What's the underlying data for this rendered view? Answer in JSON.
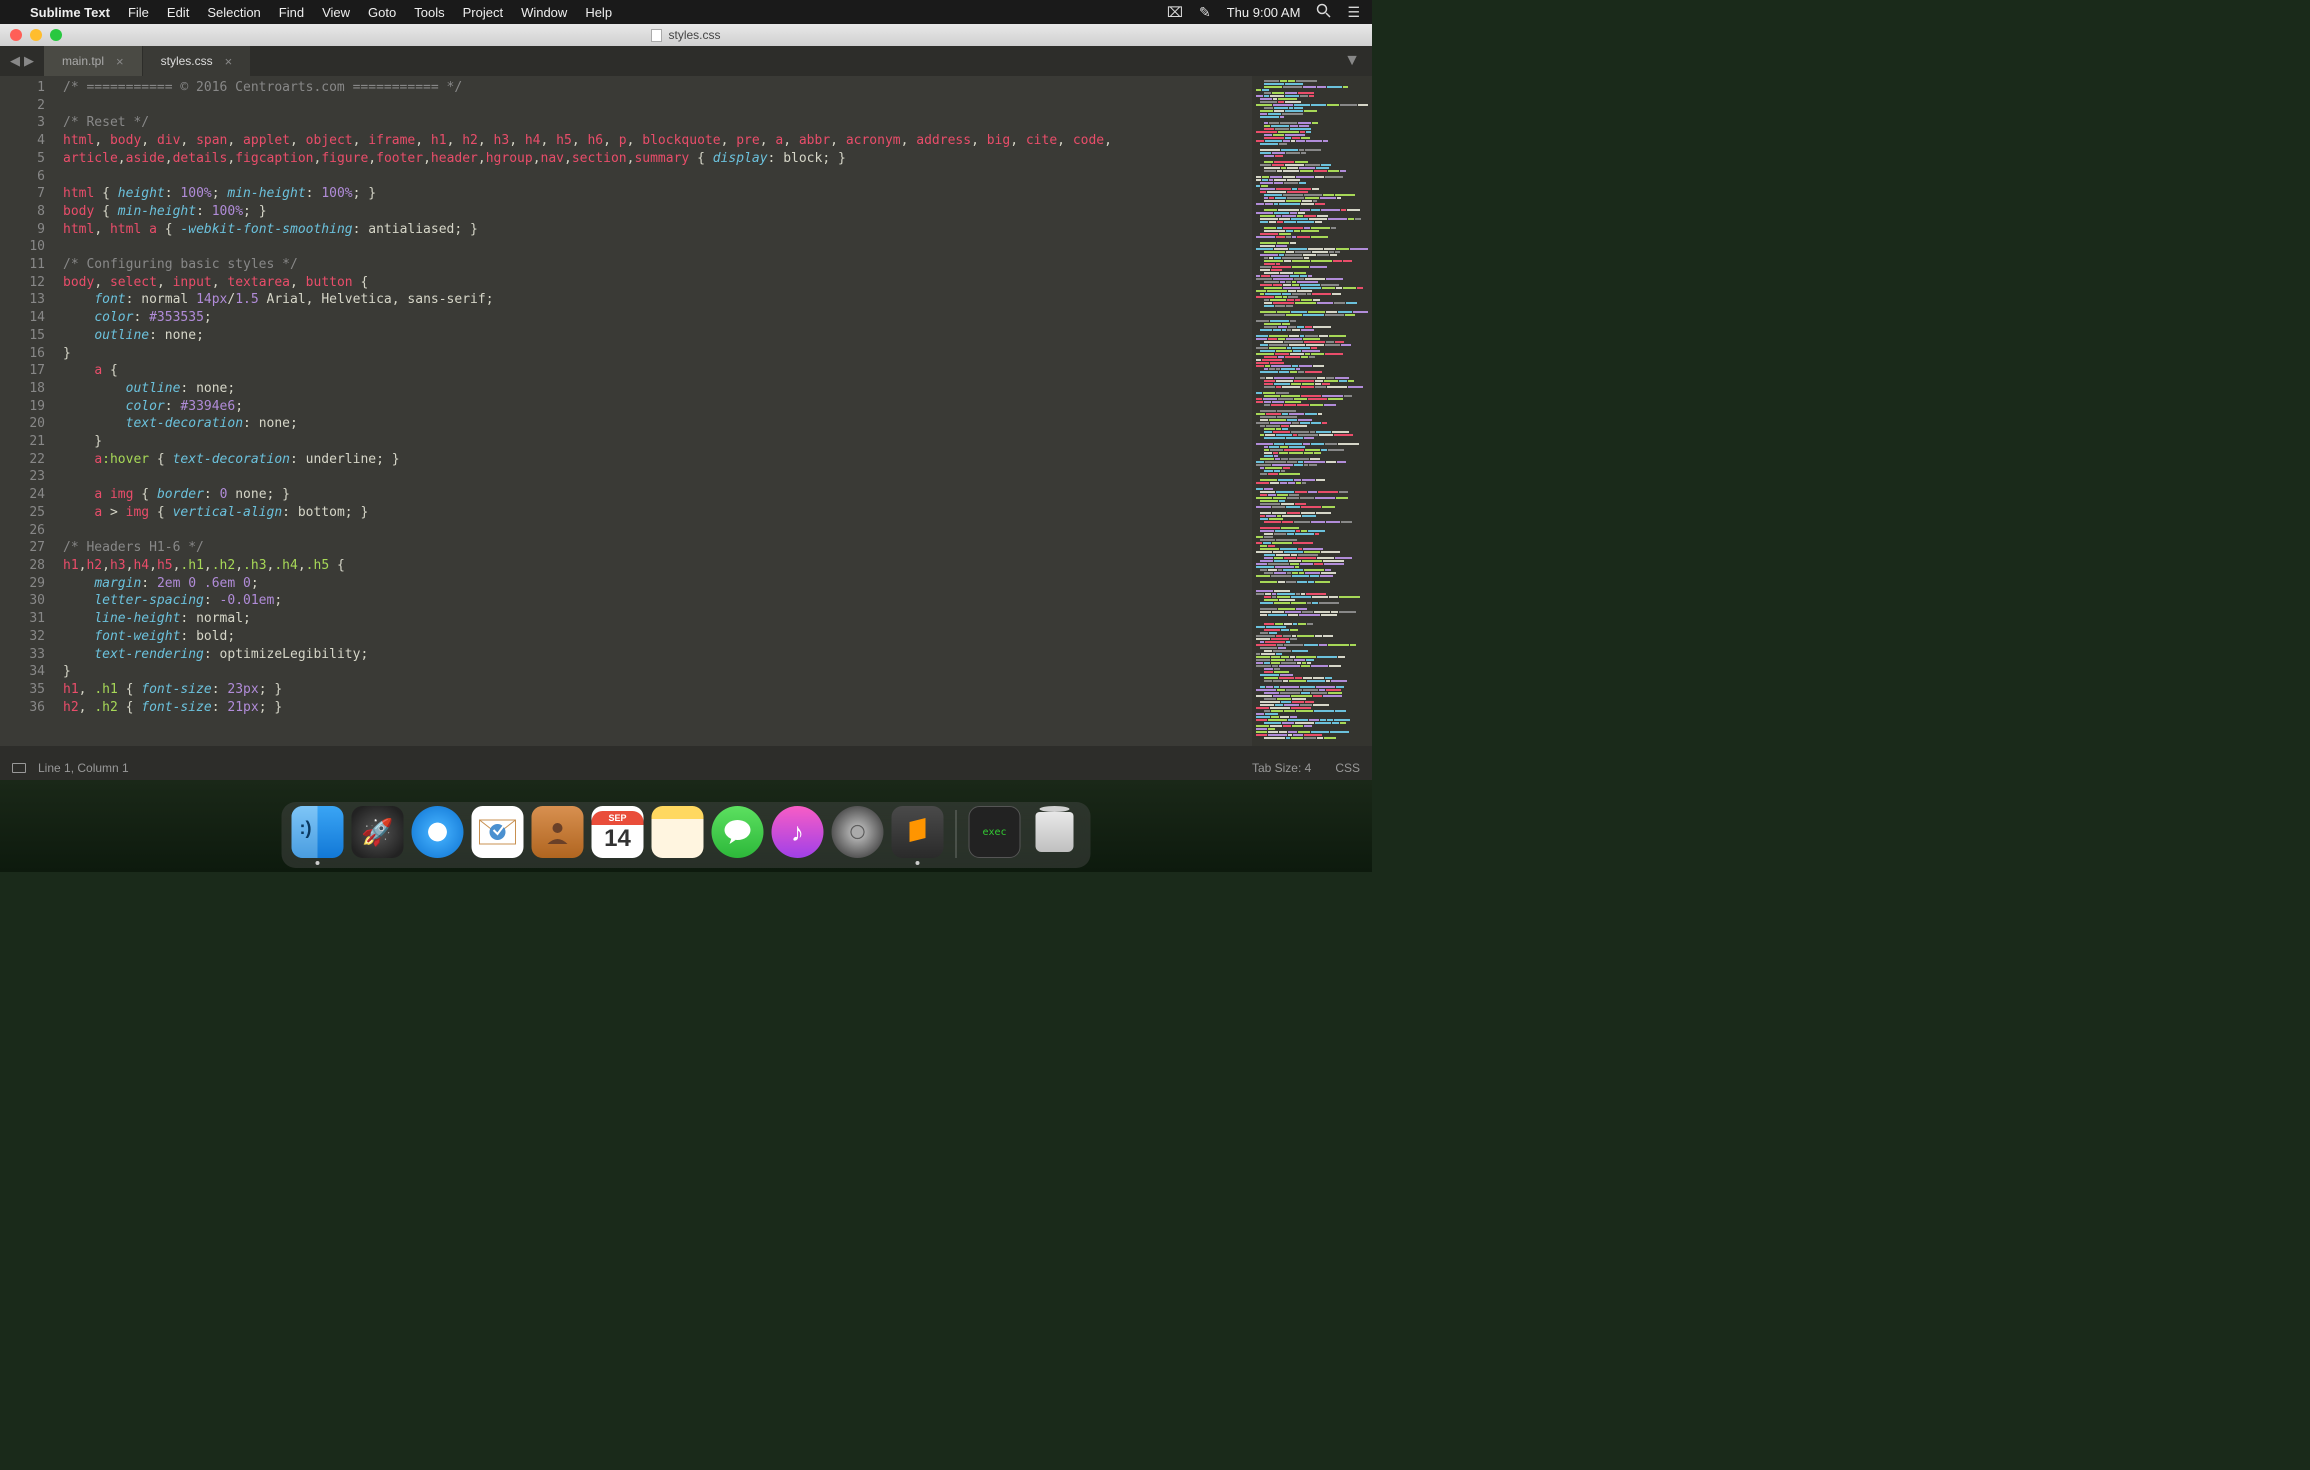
{
  "menubar": {
    "app_name": "Sublime Text",
    "items": [
      "File",
      "Edit",
      "Selection",
      "Find",
      "View",
      "Goto",
      "Tools",
      "Project",
      "Window",
      "Help"
    ],
    "clock": "Thu 9:00 AM"
  },
  "window": {
    "title": "styles.css"
  },
  "tabs": [
    {
      "label": "main.tpl",
      "active": false
    },
    {
      "label": "styles.css",
      "active": true
    }
  ],
  "code_lines": [
    [
      [
        "cm",
        "/* =========== © 2016 Centroarts.com =========== */"
      ]
    ],
    [],
    [
      [
        "cm",
        "/* Reset */"
      ]
    ],
    [
      [
        "tag",
        "html"
      ],
      [
        "punc",
        ", "
      ],
      [
        "tag",
        "body"
      ],
      [
        "punc",
        ", "
      ],
      [
        "tag",
        "div"
      ],
      [
        "punc",
        ", "
      ],
      [
        "tag",
        "span"
      ],
      [
        "punc",
        ", "
      ],
      [
        "tag",
        "applet"
      ],
      [
        "punc",
        ", "
      ],
      [
        "tag",
        "object"
      ],
      [
        "punc",
        ", "
      ],
      [
        "tag",
        "iframe"
      ],
      [
        "punc",
        ", "
      ],
      [
        "tag",
        "h1"
      ],
      [
        "punc",
        ", "
      ],
      [
        "tag",
        "h2"
      ],
      [
        "punc",
        ", "
      ],
      [
        "tag",
        "h3"
      ],
      [
        "punc",
        ", "
      ],
      [
        "tag",
        "h4"
      ],
      [
        "punc",
        ", "
      ],
      [
        "tag",
        "h5"
      ],
      [
        "punc",
        ", "
      ],
      [
        "tag",
        "h6"
      ],
      [
        "punc",
        ", "
      ],
      [
        "tag",
        "p"
      ],
      [
        "punc",
        ", "
      ],
      [
        "tag",
        "blockquote"
      ],
      [
        "punc",
        ", "
      ],
      [
        "tag",
        "pre"
      ],
      [
        "punc",
        ", "
      ],
      [
        "tag",
        "a"
      ],
      [
        "punc",
        ", "
      ],
      [
        "tag",
        "abbr"
      ],
      [
        "punc",
        ", "
      ],
      [
        "tag",
        "acronym"
      ],
      [
        "punc",
        ", "
      ],
      [
        "tag",
        "address"
      ],
      [
        "punc",
        ", "
      ],
      [
        "tag",
        "big"
      ],
      [
        "punc",
        ", "
      ],
      [
        "tag",
        "cite"
      ],
      [
        "punc",
        ", "
      ],
      [
        "tag",
        "code"
      ],
      [
        "punc",
        ", "
      ]
    ],
    [
      [
        "tag",
        "article"
      ],
      [
        "punc",
        ","
      ],
      [
        "tag",
        "aside"
      ],
      [
        "punc",
        ","
      ],
      [
        "tag",
        "details"
      ],
      [
        "punc",
        ","
      ],
      [
        "tag",
        "figcaption"
      ],
      [
        "punc",
        ","
      ],
      [
        "tag",
        "figure"
      ],
      [
        "punc",
        ","
      ],
      [
        "tag",
        "footer"
      ],
      [
        "punc",
        ","
      ],
      [
        "tag",
        "header"
      ],
      [
        "punc",
        ","
      ],
      [
        "tag",
        "hgroup"
      ],
      [
        "punc",
        ","
      ],
      [
        "tag",
        "nav"
      ],
      [
        "punc",
        ","
      ],
      [
        "tag",
        "section"
      ],
      [
        "punc",
        ","
      ],
      [
        "tag",
        "summary"
      ],
      [
        "punc",
        " { "
      ],
      [
        "prop",
        "display"
      ],
      [
        "punc",
        ": "
      ],
      [
        "val",
        "block"
      ],
      [
        "punc",
        "; }"
      ]
    ],
    [],
    [
      [
        "tag",
        "html"
      ],
      [
        "punc",
        " { "
      ],
      [
        "prop",
        "height"
      ],
      [
        "punc",
        ": "
      ],
      [
        "num",
        "100%"
      ],
      [
        "punc",
        "; "
      ],
      [
        "prop",
        "min-height"
      ],
      [
        "punc",
        ": "
      ],
      [
        "num",
        "100%"
      ],
      [
        "punc",
        "; }"
      ]
    ],
    [
      [
        "tag",
        "body"
      ],
      [
        "punc",
        " { "
      ],
      [
        "prop",
        "min-height"
      ],
      [
        "punc",
        ": "
      ],
      [
        "num",
        "100%"
      ],
      [
        "punc",
        "; }"
      ]
    ],
    [
      [
        "tag",
        "html"
      ],
      [
        "punc",
        ", "
      ],
      [
        "tag",
        "html"
      ],
      [
        "punc",
        " "
      ],
      [
        "tag",
        "a"
      ],
      [
        "punc",
        " { "
      ],
      [
        "prop",
        "-webkit-font-smoothing"
      ],
      [
        "punc",
        ": "
      ],
      [
        "val",
        "antialiased"
      ],
      [
        "punc",
        "; }"
      ]
    ],
    [],
    [
      [
        "cm",
        "/* Configuring basic styles */"
      ]
    ],
    [
      [
        "tag",
        "body"
      ],
      [
        "punc",
        ", "
      ],
      [
        "tag",
        "select"
      ],
      [
        "punc",
        ", "
      ],
      [
        "tag",
        "input"
      ],
      [
        "punc",
        ", "
      ],
      [
        "tag",
        "textarea"
      ],
      [
        "punc",
        ", "
      ],
      [
        "tag",
        "button"
      ],
      [
        "punc",
        " {"
      ]
    ],
    [
      [
        "punc",
        "    "
      ],
      [
        "prop",
        "font"
      ],
      [
        "punc",
        ": "
      ],
      [
        "val",
        "normal "
      ],
      [
        "num",
        "14px"
      ],
      [
        "punc",
        "/"
      ],
      [
        "num",
        "1.5"
      ],
      [
        "val",
        " Arial, Helvetica, sans-serif"
      ],
      [
        "punc",
        ";"
      ]
    ],
    [
      [
        "punc",
        "    "
      ],
      [
        "prop",
        "color"
      ],
      [
        "punc",
        ": "
      ],
      [
        "num",
        "#353535"
      ],
      [
        "punc",
        ";"
      ]
    ],
    [
      [
        "punc",
        "    "
      ],
      [
        "prop",
        "outline"
      ],
      [
        "punc",
        ": "
      ],
      [
        "val",
        "none"
      ],
      [
        "punc",
        ";"
      ]
    ],
    [
      [
        "punc",
        "}"
      ]
    ],
    [
      [
        "punc",
        "    "
      ],
      [
        "tag",
        "a"
      ],
      [
        "punc",
        " {"
      ]
    ],
    [
      [
        "punc",
        "        "
      ],
      [
        "prop",
        "outline"
      ],
      [
        "punc",
        ": "
      ],
      [
        "val",
        "none"
      ],
      [
        "punc",
        ";"
      ]
    ],
    [
      [
        "punc",
        "        "
      ],
      [
        "prop",
        "color"
      ],
      [
        "punc",
        ": "
      ],
      [
        "num",
        "#3394e6"
      ],
      [
        "punc",
        ";"
      ]
    ],
    [
      [
        "punc",
        "        "
      ],
      [
        "prop",
        "text-decoration"
      ],
      [
        "punc",
        ": "
      ],
      [
        "val",
        "none"
      ],
      [
        "punc",
        ";"
      ]
    ],
    [
      [
        "punc",
        "    }"
      ]
    ],
    [
      [
        "punc",
        "    "
      ],
      [
        "tag",
        "a"
      ],
      [
        "pseudo",
        ":hover"
      ],
      [
        "punc",
        " { "
      ],
      [
        "prop",
        "text-decoration"
      ],
      [
        "punc",
        ": "
      ],
      [
        "val",
        "underline"
      ],
      [
        "punc",
        "; }"
      ]
    ],
    [],
    [
      [
        "punc",
        "    "
      ],
      [
        "tag",
        "a"
      ],
      [
        "punc",
        " "
      ],
      [
        "tag",
        "img"
      ],
      [
        "punc",
        " { "
      ],
      [
        "prop",
        "border"
      ],
      [
        "punc",
        ": "
      ],
      [
        "num",
        "0"
      ],
      [
        "val",
        " none"
      ],
      [
        "punc",
        "; }"
      ]
    ],
    [
      [
        "punc",
        "    "
      ],
      [
        "tag",
        "a"
      ],
      [
        "punc",
        " > "
      ],
      [
        "tag",
        "img"
      ],
      [
        "punc",
        " { "
      ],
      [
        "prop",
        "vertical-align"
      ],
      [
        "punc",
        ": "
      ],
      [
        "val",
        "bottom"
      ],
      [
        "punc",
        "; }"
      ]
    ],
    [],
    [
      [
        "cm",
        "/* Headers H1-6 */"
      ]
    ],
    [
      [
        "tag",
        "h1"
      ],
      [
        "punc",
        ","
      ],
      [
        "tag",
        "h2"
      ],
      [
        "punc",
        ","
      ],
      [
        "tag",
        "h3"
      ],
      [
        "punc",
        ","
      ],
      [
        "tag",
        "h4"
      ],
      [
        "punc",
        ","
      ],
      [
        "tag",
        "h5"
      ],
      [
        "punc",
        ","
      ],
      [
        "cls",
        ".h1"
      ],
      [
        "punc",
        ","
      ],
      [
        "cls",
        ".h2"
      ],
      [
        "punc",
        ","
      ],
      [
        "cls",
        ".h3"
      ],
      [
        "punc",
        ","
      ],
      [
        "cls",
        ".h4"
      ],
      [
        "punc",
        ","
      ],
      [
        "cls",
        ".h5"
      ],
      [
        "punc",
        " {"
      ]
    ],
    [
      [
        "punc",
        "    "
      ],
      [
        "prop",
        "margin"
      ],
      [
        "punc",
        ": "
      ],
      [
        "num",
        "2em"
      ],
      [
        "punc",
        " "
      ],
      [
        "num",
        "0"
      ],
      [
        "punc",
        " "
      ],
      [
        "num",
        ".6em"
      ],
      [
        "punc",
        " "
      ],
      [
        "num",
        "0"
      ],
      [
        "punc",
        ";"
      ]
    ],
    [
      [
        "punc",
        "    "
      ],
      [
        "prop",
        "letter-spacing"
      ],
      [
        "punc",
        ": "
      ],
      [
        "num",
        "-0.01em"
      ],
      [
        "punc",
        ";"
      ]
    ],
    [
      [
        "punc",
        "    "
      ],
      [
        "prop",
        "line-height"
      ],
      [
        "punc",
        ": "
      ],
      [
        "val",
        "normal"
      ],
      [
        "punc",
        ";"
      ]
    ],
    [
      [
        "punc",
        "    "
      ],
      [
        "prop",
        "font-weight"
      ],
      [
        "punc",
        ": "
      ],
      [
        "val",
        "bold"
      ],
      [
        "punc",
        ";"
      ]
    ],
    [
      [
        "punc",
        "    "
      ],
      [
        "prop",
        "text-rendering"
      ],
      [
        "punc",
        ": "
      ],
      [
        "val",
        "optimizeLegibility"
      ],
      [
        "punc",
        ";"
      ]
    ],
    [
      [
        "punc",
        "}"
      ]
    ],
    [
      [
        "tag",
        "h1"
      ],
      [
        "punc",
        ", "
      ],
      [
        "cls",
        ".h1"
      ],
      [
        "punc",
        " { "
      ],
      [
        "prop",
        "font-size"
      ],
      [
        "punc",
        ": "
      ],
      [
        "num",
        "23px"
      ],
      [
        "punc",
        "; }"
      ]
    ],
    [
      [
        "tag",
        "h2"
      ],
      [
        "punc",
        ", "
      ],
      [
        "cls",
        ".h2"
      ],
      [
        "punc",
        " { "
      ],
      [
        "prop",
        "font-size"
      ],
      [
        "punc",
        ": "
      ],
      [
        "num",
        "21px"
      ],
      [
        "punc",
        "; }"
      ]
    ]
  ],
  "statusbar": {
    "position": "Line 1, Column 1",
    "tab_size": "Tab Size: 4",
    "syntax": "CSS"
  },
  "dock": {
    "calendar": {
      "month": "SEP",
      "day": "14"
    },
    "term_label": "exec"
  }
}
